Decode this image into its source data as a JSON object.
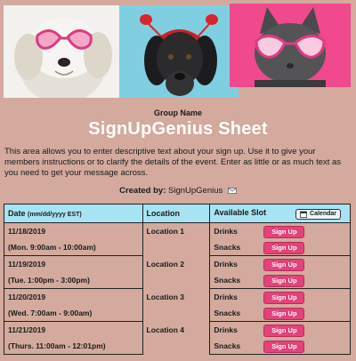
{
  "header": {
    "group_name": "Group Name",
    "title": "SignUpGenius Sheet",
    "description": "This area allows you to enter descriptive text about your sign up. Use it to give your members instructions or to clarify the details of the event. Enter as little or as much text as you need to get your message across.",
    "created_by_label": "Created by:",
    "created_by_name": "SignUpGenius"
  },
  "table": {
    "col_date": "Date",
    "col_date_unit": "(mm/dd/yyyy EST)",
    "col_location": "Location",
    "col_slot": "Available Slot",
    "calendar_label": "Calendar",
    "signup_label": "Sign Up",
    "rows": [
      {
        "date": "11/18/2019",
        "time": "(Mon. 9:00am - 10:00am)",
        "location": "Location 1",
        "slots": [
          "Drinks",
          "Snacks"
        ]
      },
      {
        "date": "11/19/2019",
        "time": "(Tue. 1:00pm - 3:00pm)",
        "location": "Location 2",
        "slots": [
          "Drinks",
          "Snacks"
        ]
      },
      {
        "date": "11/20/2019",
        "time": "(Wed. 7:00am - 9:00am)",
        "location": "Location 3",
        "slots": [
          "Drinks",
          "Snacks"
        ]
      },
      {
        "date": "11/21/2019",
        "time": "(Thurs. 11:00am - 12:01pm)",
        "location": "Location 4",
        "slots": [
          "Drinks",
          "Snacks"
        ]
      }
    ]
  },
  "colors": {
    "background": "#d3aa9d",
    "header_row": "#a6e4f3",
    "signup_button": "#e2437a"
  },
  "icons": {
    "mail": "envelope-icon",
    "calendar": "calendar-icon"
  }
}
